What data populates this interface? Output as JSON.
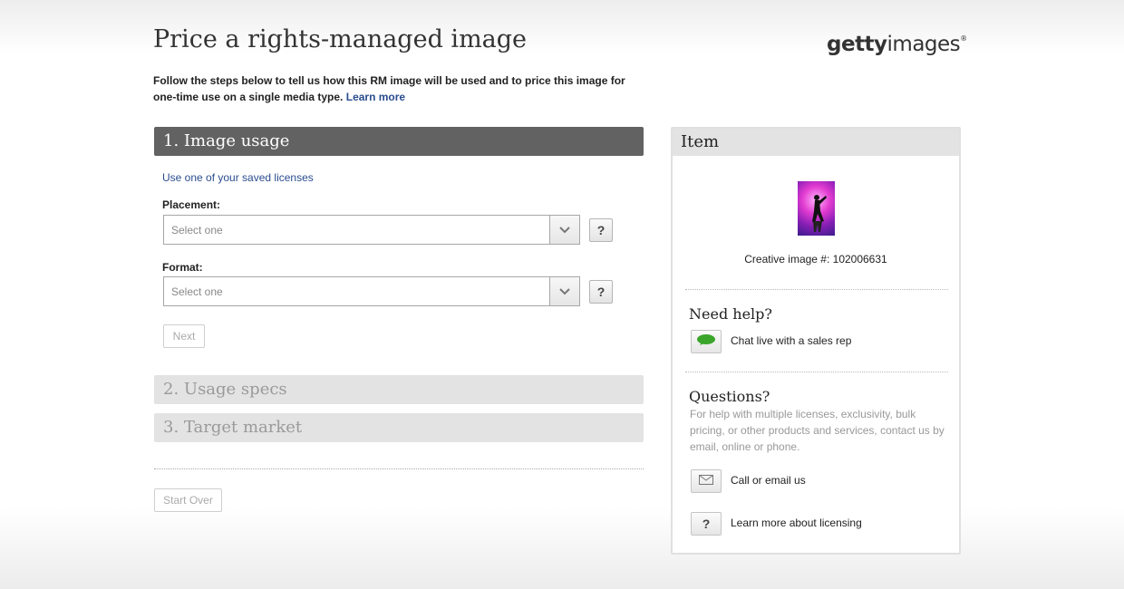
{
  "page": {
    "title": "Price a rights-managed image",
    "logo_bold": "getty",
    "logo_rest": "images",
    "logo_mark": "®",
    "intro_text": "Follow the steps below to tell us how this RM image will be used and to price this image for one-time use on a single media type.",
    "learn_more": "Learn more"
  },
  "steps": {
    "step1": "1. Image usage",
    "step2": "2. Usage specs",
    "step3": "3. Target market"
  },
  "form": {
    "saved_licenses_link": "Use one of your saved licenses",
    "placement_label": "Placement:",
    "placement_value": "Select one",
    "format_label": "Format:",
    "format_value": "Select one",
    "help_label": "?",
    "next_button": "Next",
    "start_over_button": "Start Over"
  },
  "item": {
    "header": "Item",
    "caption": "Creative image #: 102006631",
    "need_help_heading": "Need help?",
    "chat_link": "Chat live with a sales rep",
    "questions_heading": "Questions?",
    "questions_text": "For help with multiple licenses, exclusivity, bulk pricing, or other products and services, contact us by email, online or phone.",
    "call_email_link": "Call or email us",
    "licensing_icon_label": "?",
    "licensing_link": "Learn more about licensing"
  },
  "colors": {
    "active_step": "#626262",
    "inactive_step": "#e3e3e3",
    "link": "#2a4d8f",
    "chat_green": "#3aa52a"
  }
}
